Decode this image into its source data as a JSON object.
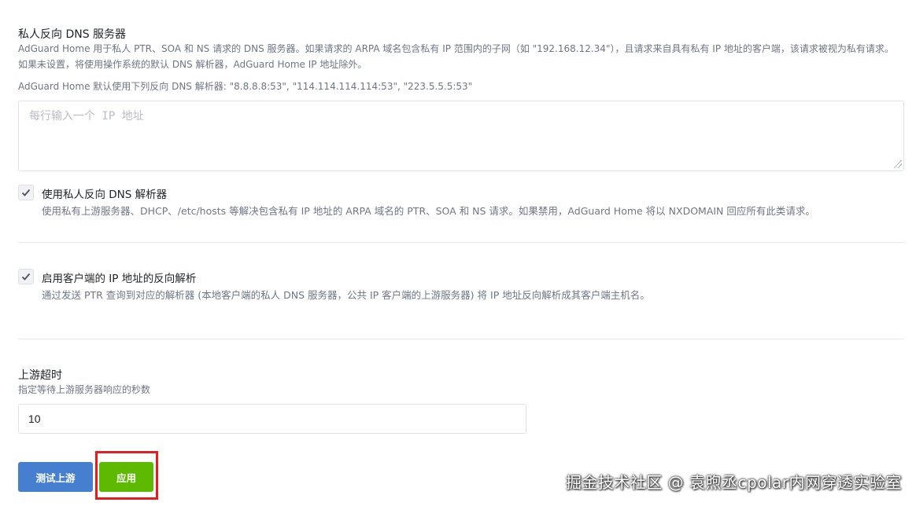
{
  "reverse_dns": {
    "title": "私人反向 DNS 服务器",
    "description": "AdGuard Home 用于私人 PTR、SOA 和 NS 请求的 DNS 服务器。如果请求的 ARPA 域名包含私有 IP 范围内的子网（如 \"192.168.12.34\"），且请求来自具有私有 IP 地址的客户端，该请求被视为私有请求。如果未设置，将使用操作系统的默认 DNS 解析器，AdGuard Home IP 地址除外。",
    "default_resolvers": "AdGuard Home 默认使用下列反向 DNS 解析器: \"8.8.8.8:53\", \"114.114.114.114:53\", \"223.5.5.5:53\"",
    "textarea_placeholder": "每行输入一个 IP 地址",
    "textarea_value": ""
  },
  "use_private_resolvers": {
    "checked": true,
    "label": "使用私人反向 DNS 解析器",
    "description": "使用私有上游服务器、DHCP、/etc/hosts 等解决包含私有 IP 地址的 ARPA 域名的 PTR、SOA 和 NS 请求。如果禁用，AdGuard Home 将以 NXDOMAIN 回应所有此类请求。"
  },
  "client_rdns": {
    "checked": true,
    "label": "启用客户端的 IP 地址的反向解析",
    "description": "通过发送 PTR 查询到对应的解析器 (本地客户端的私人 DNS 服务器，公共 IP 客户端的上游服务器) 将 IP 地址反向解析成其客户端主机名。"
  },
  "upstream_timeout": {
    "title": "上游超时",
    "description": "指定等待上游服务器响应的秒数",
    "value": "10"
  },
  "buttons": {
    "test_upstream": "测试上游",
    "apply": "应用"
  },
  "watermark": "掘金技术社区 @ 袁煦丞cpolar内网穿透实验室",
  "colors": {
    "primary_blue": "#467fcf",
    "apply_green": "#5eba00",
    "highlight_red": "#e21e1e"
  }
}
